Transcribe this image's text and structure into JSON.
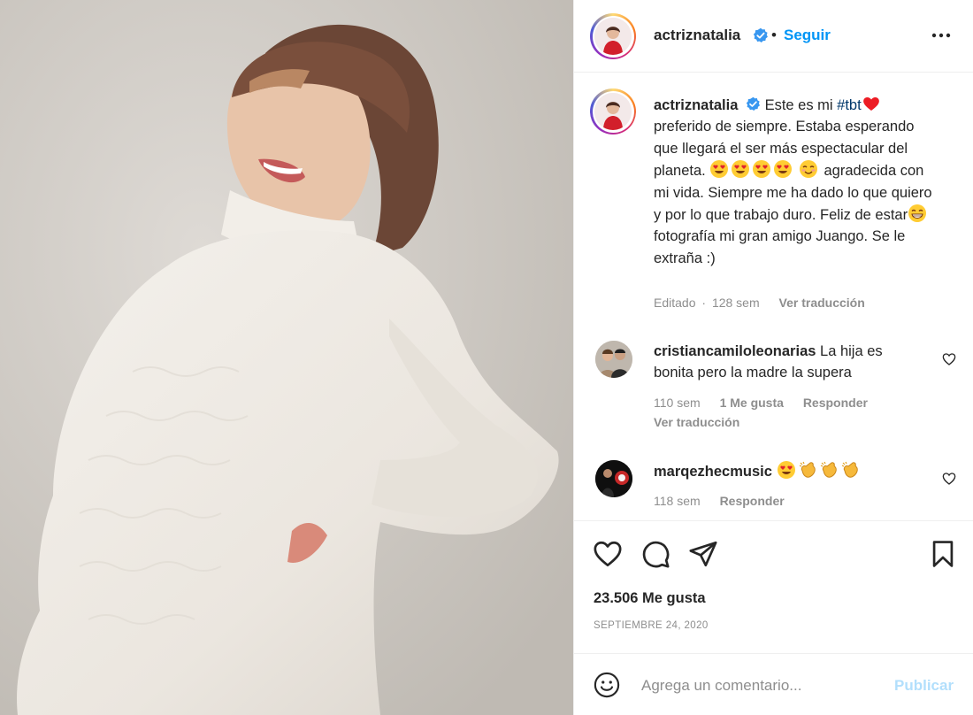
{
  "post": {
    "username": "actriznatalia",
    "dot": "•",
    "follow_label": "Seguir",
    "more_icon": "more-horizontal-icon"
  },
  "caption": {
    "username": "actriznatalia",
    "text_1": "Este es mi ",
    "hashtag": "#tbt",
    "text_2": "preferido de siempre. Estaba esperando que llegará el ser más espectacular del planeta.",
    "text_3": "agradecida con mi vida. Siempre me ha dado lo que quiero y por lo que trabajo duro. Feliz de estar",
    "text_4": "fotografía mi gran amigo Juango. Se le extraña :)",
    "edited": "Editado",
    "sep": "·",
    "time": "128 sem",
    "translate": "Ver traducción"
  },
  "comments": [
    {
      "username": "cristiancamiloleonarias",
      "text": "La hija es bonita pero la madre la supera",
      "time": "110 sem",
      "likes": "1 Me gusta",
      "reply": "Responder",
      "translate": "Ver traducción"
    },
    {
      "username": "marqezhecmusic",
      "text": "",
      "time": "118 sem",
      "reply": "Responder"
    }
  ],
  "actions": {
    "like_icon": "heart-icon",
    "comment_icon": "comment-icon",
    "share_icon": "paper-plane-icon",
    "save_icon": "bookmark-icon"
  },
  "likes": "23.506 Me gusta",
  "date": "SEPTIEMBRE 24, 2020",
  "composer": {
    "placeholder": "Agrega un comentario...",
    "publish_label": "Publicar",
    "emoji_icon": "smiley-icon"
  },
  "colors": {
    "link": "#0095f6",
    "hashtag": "#00376b",
    "muted": "#8e8e8e",
    "publish_disabled": "#b2dffc",
    "heart_red": "#ed1c24"
  }
}
